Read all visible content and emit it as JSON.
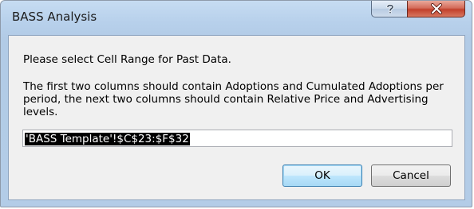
{
  "window": {
    "title": "BASS Analysis",
    "help_icon": "question-icon",
    "close_icon": "close-x-icon"
  },
  "dialog": {
    "prompt": "Please select Cell Range for Past Data.",
    "instructions": "The first two columns should contain Adoptions and Cumulated Adoptions per period, the next two columns should contain Relative Price and Advertising levels.",
    "range_value": "'BASS Template'!$C$23:$F$32"
  },
  "buttons": {
    "ok_label": "OK",
    "cancel_label": "Cancel"
  },
  "colors": {
    "title_bar": "#b7d0eb",
    "close_button": "#c2402b",
    "client_background": "#f0f0f0",
    "selection_highlight": "#000000",
    "default_button_border": "#3c7fb1"
  }
}
